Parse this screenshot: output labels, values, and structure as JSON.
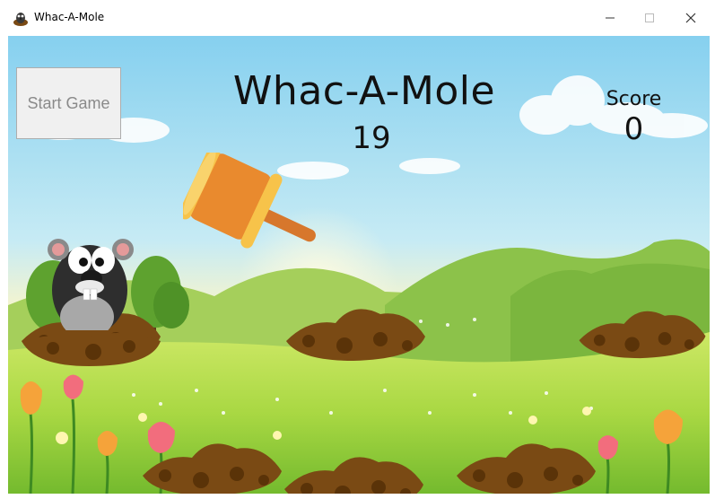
{
  "window": {
    "title": "Whac-A-Mole",
    "icon": "mole-app-icon",
    "controls": [
      "minimize-icon",
      "maximize-icon",
      "close-icon"
    ]
  },
  "game": {
    "start_button_label": "Start Game",
    "title": "Whac-A-Mole",
    "timer": "19",
    "score_label": "Score",
    "score_value": "0",
    "holes": 6,
    "mole_visible_in_hole": 1,
    "cursor_icon": "hammer-icon"
  },
  "colors": {
    "sky_top": "#8fd3ee",
    "grass_light": "#b9df4e",
    "grass_dark": "#6fb52b",
    "dirt": "#7a4a14",
    "hammer_orange": "#e98a2e"
  }
}
